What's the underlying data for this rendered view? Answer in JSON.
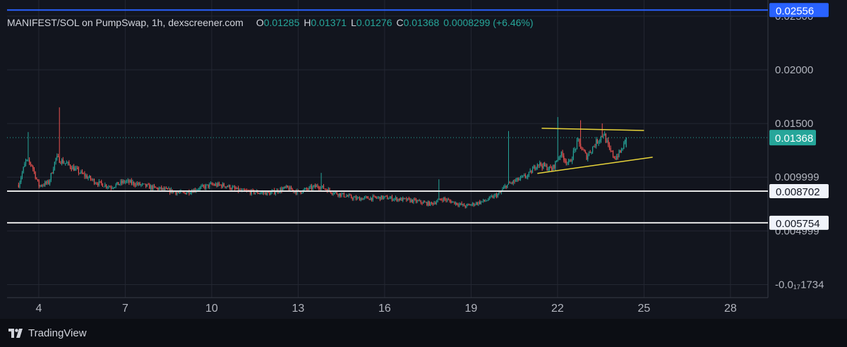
{
  "legend": {
    "title": "MANIFEST/SOL on PumpSwap, 1h, dexscreener.com",
    "open_key": "O",
    "open": "0.01285",
    "high_key": "H",
    "high": "0.01371",
    "low_key": "L",
    "low": "0.01276",
    "close_key": "C",
    "close": "0.01368",
    "change": "0.0008299 (+6.46%)"
  },
  "brand": {
    "name": "TradingView"
  },
  "colors": {
    "background": "#12151e",
    "grid": "#232732",
    "up": "#26a69a",
    "down": "#ef5350",
    "blue_line": "#2962ff",
    "white_line": "#e6e6e6",
    "trendline": "#e8d43a",
    "axis_text": "#b2b5be"
  },
  "chart_data": {
    "type": "candlestick",
    "x_ticks": [
      {
        "label": "4",
        "day": 4
      },
      {
        "label": "7",
        "day": 7
      },
      {
        "label": "10",
        "day": 10
      },
      {
        "label": "13",
        "day": 13
      },
      {
        "label": "16",
        "day": 16
      },
      {
        "label": "19",
        "day": 19
      },
      {
        "label": "22",
        "day": 22
      },
      {
        "label": "25",
        "day": 25
      },
      {
        "label": "28",
        "day": 28
      }
    ],
    "y_ticks": [
      {
        "label": "0.02000",
        "value": 0.02
      },
      {
        "label": "0.01500",
        "value": 0.015
      },
      {
        "label": "0.009999",
        "value": 0.009999
      },
      {
        "label": "0.004999",
        "value": 0.004999
      },
      {
        "label": "0.02500",
        "value": 0.025
      },
      {
        "label": "-0.0₁₇1734",
        "value": -1e-06
      }
    ],
    "ylim": [
      -0.00122,
      0.0265
    ],
    "xlim": [
      2.9,
      29.3
    ],
    "grid": true,
    "candles": {
      "start_day": 3.3,
      "end_day": 24.4,
      "interval_hours": 1,
      "last_open": 0.01285,
      "last_high": 0.01371,
      "last_low": 0.01276,
      "last_close": 0.01368,
      "path_anchors": [
        [
          3.3,
          0.0093
        ],
        [
          3.55,
          0.0115
        ],
        [
          3.75,
          0.0112
        ],
        [
          4.0,
          0.0092
        ],
        [
          4.35,
          0.0095
        ],
        [
          4.6,
          0.0118
        ],
        [
          5.0,
          0.0112
        ],
        [
          5.5,
          0.0103
        ],
        [
          6.0,
          0.0095
        ],
        [
          6.5,
          0.0091
        ],
        [
          7.0,
          0.0096
        ],
        [
          8.0,
          0.009
        ],
        [
          9.0,
          0.0085
        ],
        [
          10.0,
          0.0093
        ],
        [
          10.5,
          0.0092
        ],
        [
          11.0,
          0.0087
        ],
        [
          12.0,
          0.0085
        ],
        [
          12.6,
          0.009
        ],
        [
          13.0,
          0.0086
        ],
        [
          13.7,
          0.0092
        ],
        [
          14.2,
          0.0086
        ],
        [
          15.0,
          0.008
        ],
        [
          16.0,
          0.0081
        ],
        [
          17.0,
          0.0078
        ],
        [
          17.6,
          0.0075
        ],
        [
          18.0,
          0.008
        ],
        [
          18.8,
          0.0073
        ],
        [
          19.5,
          0.0078
        ],
        [
          20.0,
          0.0085
        ],
        [
          20.2,
          0.0092
        ],
        [
          20.5,
          0.0096
        ],
        [
          21.0,
          0.0102
        ],
        [
          21.3,
          0.0113
        ],
        [
          21.8,
          0.0107
        ],
        [
          22.1,
          0.0122
        ],
        [
          22.4,
          0.0112
        ],
        [
          22.7,
          0.0133
        ],
        [
          23.0,
          0.0119
        ],
        [
          23.3,
          0.0131
        ],
        [
          23.6,
          0.0141
        ],
        [
          23.8,
          0.0125
        ],
        [
          24.0,
          0.0118
        ],
        [
          24.2,
          0.0124
        ],
        [
          24.4,
          0.01368
        ]
      ],
      "spikes": [
        {
          "day": 3.65,
          "high": 0.0142
        },
        {
          "day": 4.7,
          "high": 0.0165
        },
        {
          "day": 13.8,
          "high": 0.0104
        },
        {
          "day": 17.9,
          "high": 0.0098
        },
        {
          "day": 20.3,
          "high": 0.0143
        },
        {
          "day": 22.0,
          "high": 0.0156
        },
        {
          "day": 22.8,
          "high": 0.0153
        },
        {
          "day": 23.55,
          "high": 0.015
        }
      ]
    },
    "horizontal_lines": [
      {
        "name": "blue-level",
        "value": 0.02556,
        "label": "0.02556"
      },
      {
        "name": "upper-support",
        "value": 0.008702,
        "label": "0.008702"
      },
      {
        "name": "lower-support",
        "value": 0.005754,
        "label": "0.005754"
      }
    ],
    "current_price": {
      "value": 0.01368,
      "label": "0.01368"
    },
    "trendlines": [
      {
        "name": "triangle-top",
        "from": [
          21.45,
          0.01455
        ],
        "to": [
          25.0,
          0.01435
        ]
      },
      {
        "name": "triangle-bottom",
        "from": [
          21.3,
          0.01035
        ],
        "to": [
          25.3,
          0.01186
        ]
      }
    ]
  }
}
